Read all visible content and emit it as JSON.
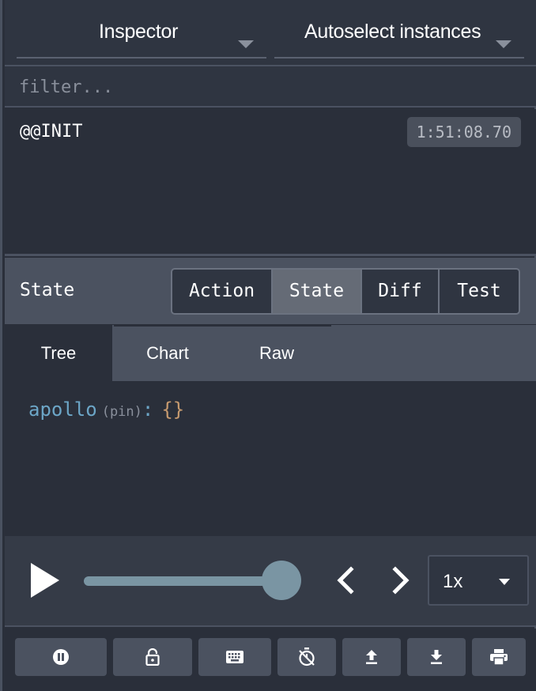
{
  "top": {
    "monitor_select": "Inspector",
    "instance_select": "Autoselect instances"
  },
  "filter": {
    "placeholder": "filter..."
  },
  "actions": [
    {
      "name": "@@INIT",
      "time": "1:51:08.70"
    }
  ],
  "monitor": {
    "title": "State",
    "tabs": [
      "Action",
      "State",
      "Diff",
      "Test"
    ],
    "active_tab": "State",
    "subtabs": [
      "Tree",
      "Chart",
      "Raw"
    ],
    "active_subtab": "Tree"
  },
  "state_tree": {
    "key": "apollo",
    "pin": "(pin)",
    "colon": ":",
    "value": "{}"
  },
  "player": {
    "speed": "1x",
    "slider_position_percent": 100
  },
  "buttons": [
    {
      "icon": "pause-icon"
    },
    {
      "icon": "lock-open-icon"
    },
    {
      "icon": "keyboard-icon"
    },
    {
      "icon": "timer-off-icon"
    },
    {
      "icon": "upload-icon"
    },
    {
      "icon": "download-icon"
    },
    {
      "icon": "print-icon"
    }
  ]
}
